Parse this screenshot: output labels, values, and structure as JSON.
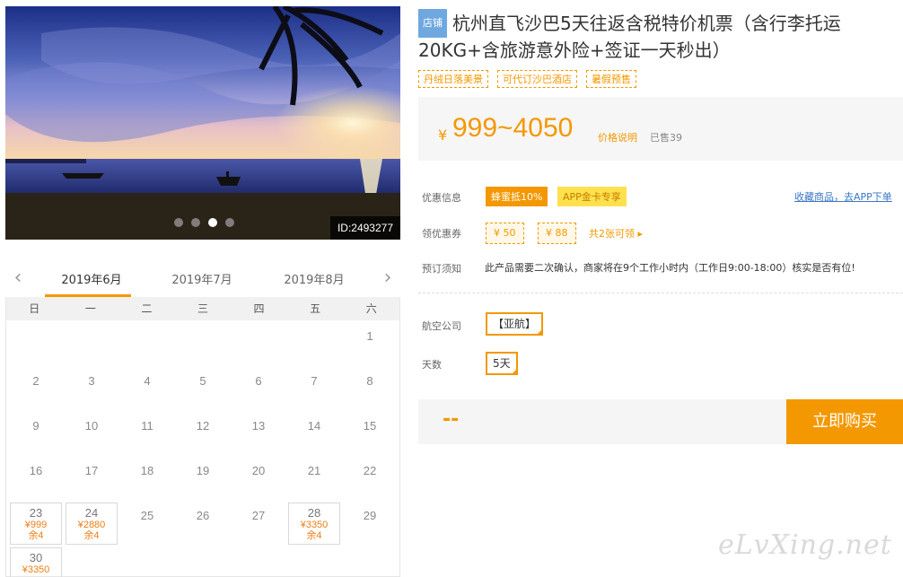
{
  "hero": {
    "id_label": "ID:2493277",
    "slides": 4,
    "active_slide": 3
  },
  "calendar": {
    "months": [
      "2019年6月",
      "2019年7月",
      "2019年8月"
    ],
    "active_month": 0,
    "prev_icon": "chevron-left-icon",
    "next_icon": "chevron-right-icon",
    "weekdays": [
      "日",
      "一",
      "二",
      "三",
      "四",
      "五",
      "六"
    ],
    "days": [
      {
        "d": "",
        "p": "",
        "l": ""
      },
      {
        "d": "",
        "p": "",
        "l": ""
      },
      {
        "d": "",
        "p": "",
        "l": ""
      },
      {
        "d": "",
        "p": "",
        "l": ""
      },
      {
        "d": "",
        "p": "",
        "l": ""
      },
      {
        "d": "",
        "p": "",
        "l": ""
      },
      {
        "d": "1",
        "p": "",
        "l": ""
      },
      {
        "d": "2",
        "p": "",
        "l": ""
      },
      {
        "d": "3",
        "p": "",
        "l": ""
      },
      {
        "d": "4",
        "p": "",
        "l": ""
      },
      {
        "d": "5",
        "p": "",
        "l": ""
      },
      {
        "d": "6",
        "p": "",
        "l": ""
      },
      {
        "d": "7",
        "p": "",
        "l": ""
      },
      {
        "d": "8",
        "p": "",
        "l": ""
      },
      {
        "d": "9",
        "p": "",
        "l": ""
      },
      {
        "d": "10",
        "p": "",
        "l": ""
      },
      {
        "d": "11",
        "p": "",
        "l": ""
      },
      {
        "d": "12",
        "p": "",
        "l": ""
      },
      {
        "d": "13",
        "p": "",
        "l": ""
      },
      {
        "d": "14",
        "p": "",
        "l": ""
      },
      {
        "d": "15",
        "p": "",
        "l": ""
      },
      {
        "d": "16",
        "p": "",
        "l": ""
      },
      {
        "d": "17",
        "p": "",
        "l": ""
      },
      {
        "d": "18",
        "p": "",
        "l": ""
      },
      {
        "d": "19",
        "p": "",
        "l": ""
      },
      {
        "d": "20",
        "p": "",
        "l": ""
      },
      {
        "d": "21",
        "p": "",
        "l": ""
      },
      {
        "d": "22",
        "p": "",
        "l": ""
      },
      {
        "d": "23",
        "p": "¥999",
        "l": "余4"
      },
      {
        "d": "24",
        "p": "¥2880",
        "l": "余4"
      },
      {
        "d": "25",
        "p": "",
        "l": ""
      },
      {
        "d": "26",
        "p": "",
        "l": ""
      },
      {
        "d": "27",
        "p": "",
        "l": ""
      },
      {
        "d": "28",
        "p": "¥3350",
        "l": "余4"
      },
      {
        "d": "29",
        "p": "",
        "l": ""
      },
      {
        "d": "30",
        "p": "¥3350",
        "l": ""
      }
    ]
  },
  "product": {
    "shop_badge": "店铺",
    "title": "杭州直飞沙巴5天往返含税特价机票（含行李托运20KG+含旅游意外险+签证一天秒出）",
    "tags": [
      "丹绒日落美景",
      "可代订沙巴酒店",
      "暑假预售"
    ],
    "price_currency": "¥",
    "price_range": "999~4050",
    "price_note": "价格说明",
    "sold": "已售39"
  },
  "promotions": {
    "label": "优惠信息",
    "tag1": "蜂蜜抵10%",
    "tag2": "APP金卡专享",
    "fav_link": "收藏商品，去APP下单"
  },
  "coupons": {
    "label": "领优惠券",
    "items": [
      "¥ 50",
      "¥ 88"
    ],
    "more": "共2张可领 ▸"
  },
  "booking": {
    "label": "预订须知",
    "notice": "此产品需要二次确认，商家将在9个工作小时内（工作日9:00-18:00）核实是否有位!"
  },
  "options": {
    "airline_label": "航空公司",
    "airline_value": "【亚航】",
    "days_label": "天数",
    "days_value": "5天"
  },
  "buy": {
    "placeholder": "--",
    "button": "立即购买"
  },
  "watermark": "eLvXing.net",
  "colors": {
    "accent": "#f39800",
    "link": "#3a77c5"
  }
}
